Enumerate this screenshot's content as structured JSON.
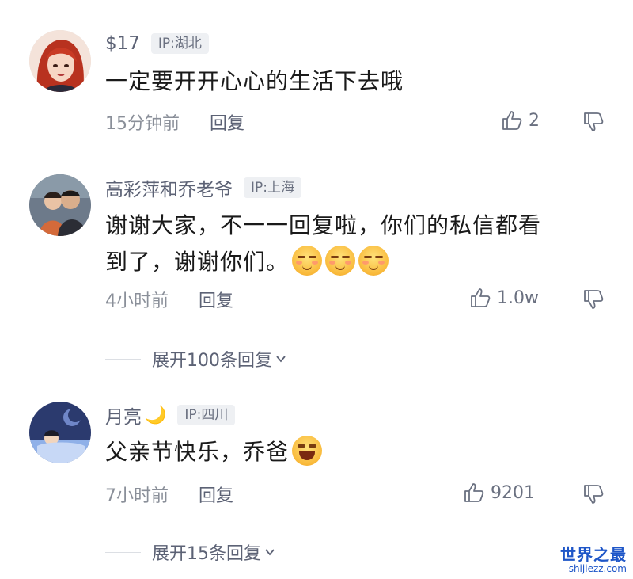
{
  "comments": [
    {
      "username": "$17",
      "ip": "IP:湖北",
      "text": "一定要开开心心的生活下去哦",
      "time": "15分钟前",
      "reply_label": "回复",
      "likes": "2",
      "avatar_icon": "red-hair-girl-avatar"
    },
    {
      "username": "高彩萍和乔老爷",
      "ip": "IP:上海",
      "text_line1": "谢谢大家，不一一回复啦，你们的私信都看",
      "text_line2": "到了，谢谢你们。",
      "time": "4小时前",
      "reply_label": "回复",
      "likes": "1.0w",
      "avatar_icon": "couple-photo-avatar"
    },
    {
      "username": "月亮",
      "ip": "IP:四川",
      "text": "父亲节快乐，乔爸",
      "time": "7小时前",
      "reply_label": "回复",
      "likes": "9201",
      "avatar_icon": "sleeping-moon-avatar"
    }
  ],
  "expand1": "展开100条回复",
  "expand2": "展开15条回复",
  "watermark": {
    "title": "世界之最",
    "subtitle": "shijiezz.com"
  },
  "colors": {
    "username": "#5c6275",
    "text": "#1a1a1a",
    "meta": "#8a8f99",
    "badge_bg": "#eef0f3"
  }
}
